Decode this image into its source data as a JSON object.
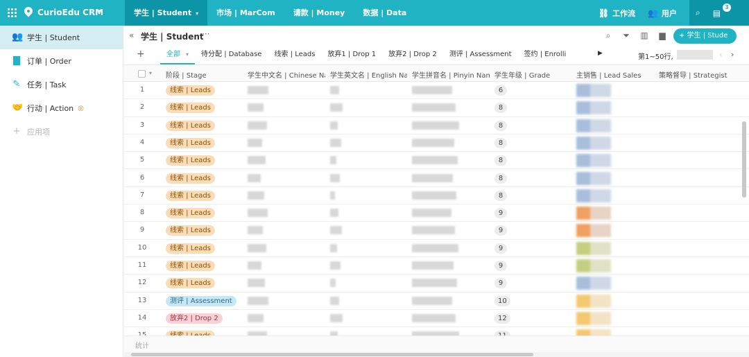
{
  "app": {
    "name": "CurioEdu CRM"
  },
  "nav": [
    {
      "label": "学生 | Student",
      "active": true
    },
    {
      "label": "市场 | MarCom",
      "active": false
    },
    {
      "label": "请款 | Money",
      "active": false
    },
    {
      "label": "数据 | Data",
      "active": false
    }
  ],
  "top_right": {
    "workflow": "工作流",
    "users": "用户",
    "notification_count": "3"
  },
  "sidebar": {
    "items": [
      {
        "label": "学生 | Student",
        "icon": "users-icon",
        "active": true
      },
      {
        "label": "订单 | Order",
        "icon": "document-icon",
        "active": false
      },
      {
        "label": "任务 | Task",
        "icon": "edit-icon",
        "active": false
      },
      {
        "label": "行动 | Action",
        "icon": "handshake-icon",
        "active": false
      },
      {
        "label": "应用项",
        "icon": "plus-icon",
        "active": false
      }
    ]
  },
  "view": {
    "title": "学生 | Student",
    "add_button": "+ 学生 | Stude"
  },
  "tabs": [
    {
      "label": "全部",
      "active": true
    },
    {
      "label": "待分配 | Database",
      "active": false
    },
    {
      "label": "线索 | Leads",
      "active": false
    },
    {
      "label": "放弃1 | Drop 1",
      "active": false
    },
    {
      "label": "放弃2 | Drop 2",
      "active": false
    },
    {
      "label": "测评 | Assessment",
      "active": false
    },
    {
      "label": "签约 | Enrolli",
      "active": false
    }
  ],
  "pager": {
    "range": "第1~50行,"
  },
  "table": {
    "columns": [
      "阶段 | Stage",
      "学生中文名 | Chinese Na",
      "学生英文名 | English Nar",
      "学生拼音名 | Pinyin Nam",
      "学生年级 | Grade",
      "主销售 | Lead Sales",
      "策略督导 | Strategist"
    ],
    "rows": [
      {
        "n": "1",
        "stage": "线索 | Leads",
        "kind": "leads",
        "grade": "6",
        "c1": "#a8bedc",
        "c2": "#cfd8e6"
      },
      {
        "n": "2",
        "stage": "线索 | Leads",
        "kind": "leads",
        "grade": "8",
        "c1": "#a8bedc",
        "c2": "#cfd8e6"
      },
      {
        "n": "3",
        "stage": "线索 | Leads",
        "kind": "leads",
        "grade": "8",
        "c1": "#a8bedc",
        "c2": "#cfd8e6"
      },
      {
        "n": "4",
        "stage": "线索 | Leads",
        "kind": "leads",
        "grade": "8",
        "c1": "#a8bedc",
        "c2": "#cfd8e6"
      },
      {
        "n": "5",
        "stage": "线索 | Leads",
        "kind": "leads",
        "grade": "8",
        "c1": "#a8bedc",
        "c2": "#cfd8e6"
      },
      {
        "n": "6",
        "stage": "线索 | Leads",
        "kind": "leads",
        "grade": "8",
        "c1": "#a8bedc",
        "c2": "#cfd8e6"
      },
      {
        "n": "7",
        "stage": "线索 | Leads",
        "kind": "leads",
        "grade": "8",
        "c1": "#a8bedc",
        "c2": "#cfd8e6"
      },
      {
        "n": "8",
        "stage": "线索 | Leads",
        "kind": "leads",
        "grade": "9",
        "c1": "#f0a060",
        "c2": "#e8d4c4"
      },
      {
        "n": "9",
        "stage": "线索 | Leads",
        "kind": "leads",
        "grade": "9",
        "c1": "#f0a060",
        "c2": "#e8d4c4"
      },
      {
        "n": "10",
        "stage": "线索 | Leads",
        "kind": "leads",
        "grade": "9",
        "c1": "#c4d080",
        "c2": "#dfe2c6"
      },
      {
        "n": "11",
        "stage": "线索 | Leads",
        "kind": "leads",
        "grade": "9",
        "c1": "#c4d080",
        "c2": "#dfe2c6"
      },
      {
        "n": "12",
        "stage": "线索 | Leads",
        "kind": "leads",
        "grade": "9",
        "c1": "#a8bedc",
        "c2": "#cfd8e6"
      },
      {
        "n": "13",
        "stage": "测评 | Assessment",
        "kind": "assess",
        "grade": "10",
        "c1": "#f4c870",
        "c2": "#f2e4c4"
      },
      {
        "n": "14",
        "stage": "放弃2 | Drop 2",
        "kind": "drop2",
        "grade": "12",
        "c1": "#f4c870",
        "c2": "#f2e4c4"
      },
      {
        "n": "15",
        "stage": "线索 | Leads",
        "kind": "leads",
        "grade": "11",
        "c1": "#f4c870",
        "c2": "#f2e4c4"
      }
    ]
  },
  "footer": {
    "label": "统计"
  }
}
